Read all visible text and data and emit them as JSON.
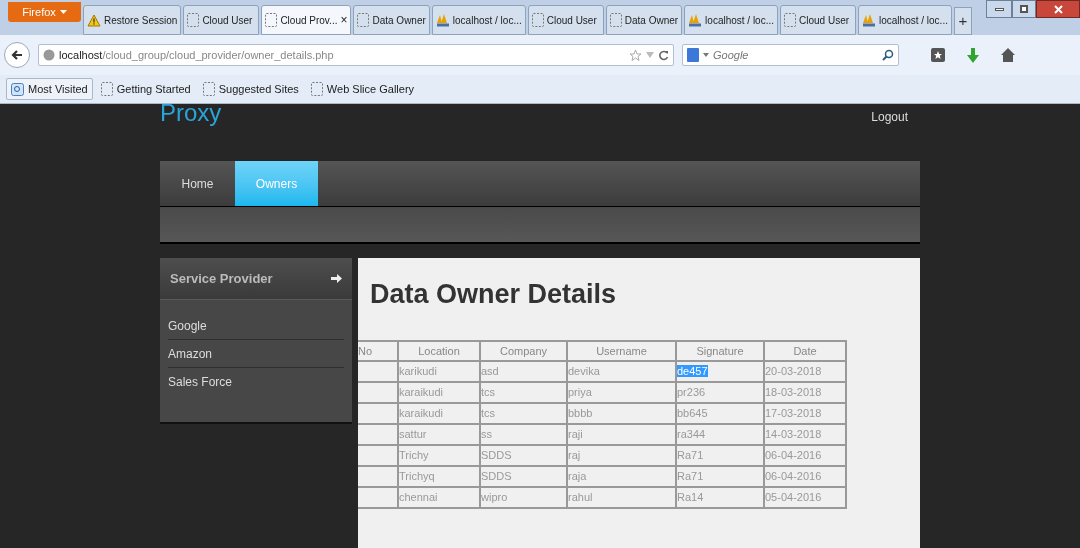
{
  "browser": {
    "menu_button": "Firefox",
    "tabs": [
      {
        "label": "Restore Session",
        "kind": "warning",
        "selected": false
      },
      {
        "label": "Cloud User",
        "kind": "page",
        "selected": false
      },
      {
        "label": "Cloud Prov...",
        "kind": "page",
        "selected": true,
        "close": "×"
      },
      {
        "label": "Data Owner",
        "kind": "page",
        "selected": false
      },
      {
        "label": "localhost / loc...",
        "kind": "pma",
        "selected": false
      },
      {
        "label": "Cloud User",
        "kind": "page",
        "selected": false
      },
      {
        "label": "Data Owner",
        "kind": "page",
        "selected": false
      },
      {
        "label": "localhost / loc...",
        "kind": "pma",
        "selected": false
      },
      {
        "label": "Cloud User",
        "kind": "page",
        "selected": false
      },
      {
        "label": "localhost / loc...",
        "kind": "pma",
        "selected": false
      }
    ],
    "new_tab": "+",
    "url": {
      "host": "localhost",
      "path": "/cloud_group/cloud_provider/owner_details.php"
    },
    "search_placeholder": "Google",
    "bookmarks": [
      {
        "label": "Most Visited",
        "kind": "special"
      },
      {
        "label": "Getting Started",
        "kind": "page"
      },
      {
        "label": "Suggested Sites",
        "kind": "page"
      },
      {
        "label": "Web Slice Gallery",
        "kind": "page"
      }
    ]
  },
  "site": {
    "logo": "Proxy",
    "logout": "Logout",
    "nav": [
      {
        "label": "Home",
        "selected": false
      },
      {
        "label": "Owners",
        "selected": true
      }
    ],
    "sidebar": {
      "title": "Service Provider",
      "items": [
        "Google",
        "Amazon",
        "Sales Force"
      ]
    },
    "heading": "Data Owner Details",
    "table": {
      "columns": [
        "No",
        "Location",
        "Company",
        "Username",
        "Signature",
        "Date"
      ],
      "rows": [
        {
          "cells": [
            "",
            "karikudi",
            "asd",
            "devika",
            "de457",
            "20-03-2018"
          ],
          "signature_highlighted": true
        },
        {
          "cells": [
            "",
            "karaikudi",
            "tcs",
            "priya",
            "pr236",
            "18-03-2018"
          ],
          "signature_highlighted": false
        },
        {
          "cells": [
            "",
            "karaikudi",
            "tcs",
            "bbbb",
            "bb645",
            "17-03-2018"
          ],
          "signature_highlighted": false
        },
        {
          "cells": [
            "",
            "sattur",
            "ss",
            "raji",
            "ra344",
            "14-03-2018"
          ],
          "signature_highlighted": false
        },
        {
          "cells": [
            "",
            "Trichy",
            "SDDS",
            "raj",
            "Ra71",
            "06-04-2016"
          ],
          "signature_highlighted": false
        },
        {
          "cells": [
            "",
            "Trichyq",
            "SDDS",
            "raja",
            "Ra71",
            "06-04-2016"
          ],
          "signature_highlighted": false
        },
        {
          "cells": [
            "",
            "chennai",
            "wipro",
            "rahul",
            "Ra14",
            "05-04-2016"
          ],
          "signature_highlighted": false
        }
      ]
    }
  }
}
